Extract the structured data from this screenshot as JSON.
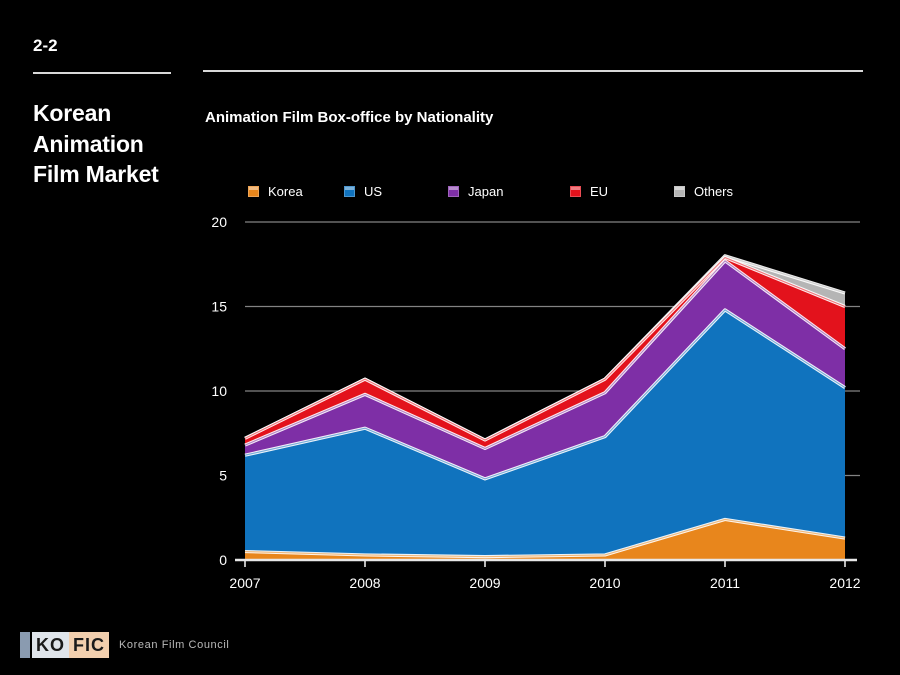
{
  "sidebar": {
    "slide_number": "2-2",
    "title": "Korean Animation Film Market"
  },
  "chart_panel": {
    "title": "Animation Film Box-office by Nationality"
  },
  "footer": {
    "logo_mark": "",
    "logo_text_1": "KO",
    "logo_text_2": "FIC",
    "caption": "Korean Film Council"
  },
  "chart_data": {
    "type": "area",
    "stacked": true,
    "title": "Animation Film Box-office by Nationality",
    "xlabel": "",
    "ylabel": "",
    "x": [
      "2007",
      "2008",
      "2009",
      "2010",
      "2011",
      "2012"
    ],
    "categories": [
      "2007",
      "2008",
      "2009",
      "2010",
      "2011",
      "2012"
    ],
    "xtick_labels": [
      "2007",
      "2008",
      "2009",
      "2010",
      "2011",
      "2012"
    ],
    "ytick_labels": [
      "0",
      "5",
      "10",
      "15",
      "20"
    ],
    "yticks": [
      0,
      5,
      10,
      15,
      20
    ],
    "ylim": [
      0,
      20
    ],
    "grid": true,
    "legend_position": "top",
    "series": [
      {
        "name": "Korea",
        "color": "#E8861C",
        "values": [
          0.5,
          0.3,
          0.2,
          0.3,
          2.4,
          1.3
        ]
      },
      {
        "name": "US",
        "color": "#1073BE",
        "values": [
          5.7,
          7.5,
          4.6,
          7.0,
          12.4,
          8.9
        ]
      },
      {
        "name": "Japan",
        "color": "#7E2FA6",
        "values": [
          0.6,
          2.0,
          1.8,
          2.6,
          2.9,
          2.3
        ]
      },
      {
        "name": "EU",
        "color": "#E3121C",
        "values": [
          0.4,
          0.9,
          0.5,
          0.8,
          0.2,
          2.5
        ]
      },
      {
        "name": "Others",
        "color": "#B5B5B5",
        "values": [
          0.0,
          0.0,
          0.0,
          0.0,
          0.1,
          0.8
        ]
      }
    ],
    "cumulative_tops": {
      "Korea": [
        0.5,
        0.3,
        0.2,
        0.3,
        2.4,
        1.3
      ],
      "US": [
        6.2,
        7.8,
        4.8,
        7.3,
        14.8,
        10.2
      ],
      "Japan": [
        6.8,
        9.8,
        6.6,
        9.9,
        17.7,
        12.5
      ],
      "EU": [
        7.2,
        10.7,
        7.1,
        10.7,
        17.9,
        15.0
      ],
      "Others": [
        7.2,
        10.7,
        7.1,
        10.7,
        18.0,
        15.8
      ]
    },
    "colors": {
      "korea": "#E8861C",
      "us": "#1073BE",
      "japan": "#7E2FA6",
      "eu": "#E3121C",
      "others": "#B5B5B5",
      "background": "#000000",
      "axis": "#E8E8E8",
      "grid": "#9A9A9A"
    }
  }
}
